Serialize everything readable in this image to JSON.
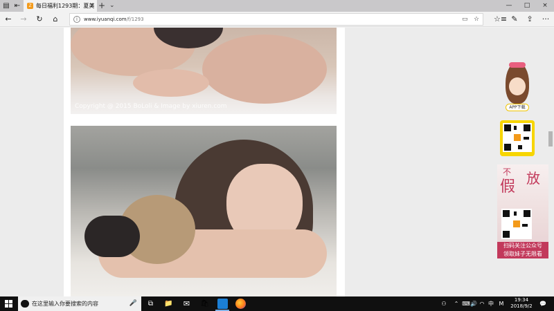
{
  "browser": {
    "tab": {
      "title": "每日福利1293期：夏美",
      "favicon_label": "Z"
    },
    "address": {
      "host": "www.iyuanqi.com",
      "path": "/f/1293"
    }
  },
  "content": {
    "photo1": {
      "watermark": "Copyright @ 2015 BoLoli & Image by xiuren.com"
    }
  },
  "sidebar_ads": {
    "app": {
      "button_label": "APP下载"
    },
    "promo": {
      "title_chars": [
        "不",
        "假",
        "放"
      ],
      "line1": "扫码关注公众号",
      "line2": "领取妹子无限看"
    }
  },
  "taskbar": {
    "search_placeholder": "在这里输入你要搜索的内容",
    "ime": "中",
    "ime_mode": "M",
    "time": "19:34",
    "date": "2018/9/2"
  },
  "colors": {
    "taskbar_bg": "#101010",
    "qr_ad_bg": "#f7d500",
    "promo_accent": "#c2395b",
    "edge_accent": "#1b7fd6",
    "firefox": "#ff7a1a"
  },
  "icons": {
    "back": "←",
    "forward": "→",
    "refresh": "↻",
    "home": "⌂",
    "star": "☆",
    "favorites": "☆≡",
    "pen": "✎",
    "share": "⇪",
    "more": "···",
    "new_tab": "+",
    "tab_list": "⌄",
    "close": "×",
    "minimize": "—",
    "maximize": "□",
    "mic": "🎤",
    "reader": "▭",
    "people": "⚇",
    "chevron_up": "⌃",
    "speaker": "🔊",
    "wifi": "◠",
    "keyboard": "⌨",
    "notification": "💬",
    "task_view": "⧉",
    "file_explorer": "📁",
    "mail": "✉",
    "store": "🛍"
  }
}
